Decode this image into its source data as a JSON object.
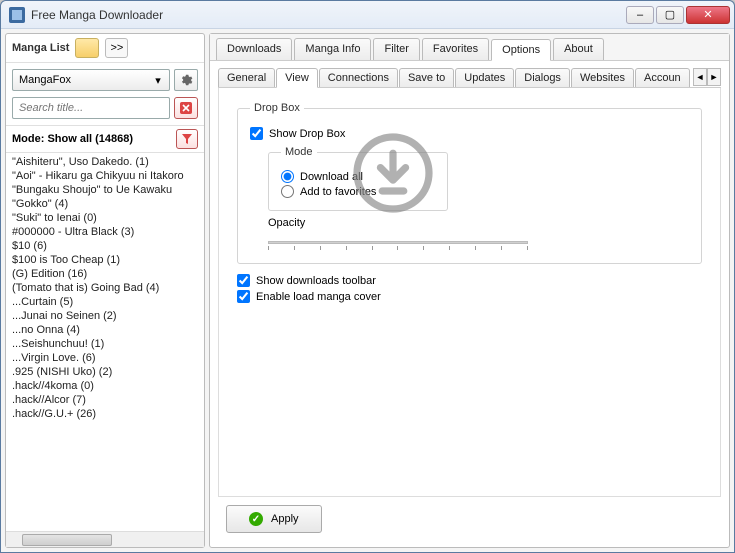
{
  "window": {
    "title": "Free Manga Downloader",
    "buttons": {
      "min": "–",
      "max": "▢",
      "close": "✕"
    }
  },
  "sidebar": {
    "title": "Manga List",
    "expand_label": ">>",
    "source": "MangaFox",
    "search_placeholder": "Search title...",
    "mode": "Mode: Show all (14868)",
    "items": [
      "\"Aishiteru\", Uso Dakedo. (1)",
      "\"Aoi\" - Hikaru ga Chikyuu ni Itakoro",
      "\"Bungaku Shoujo\" to Ue Kawaku",
      "\"Gokko\" (4)",
      "\"Suki\" to Ienai (0)",
      "#000000 - Ultra Black (3)",
      "$10 (6)",
      "$100 is Too Cheap (1)",
      "(G) Edition (16)",
      "(Tomato that is) Going Bad (4)",
      "...Curtain (5)",
      "...Junai no Seinen (2)",
      "...no Onna (4)",
      "...Seishunchuu! (1)",
      "...Virgin Love. (6)",
      ".925 (NISHI Uko) (2)",
      ".hack//4koma (0)",
      ".hack//Alcor (7)",
      ".hack//G.U.+ (26)"
    ]
  },
  "tabs": {
    "items": [
      "Downloads",
      "Manga Info",
      "Filter",
      "Favorites",
      "Options",
      "About"
    ],
    "active": "Options"
  },
  "subtabs": {
    "items": [
      "General",
      "View",
      "Connections",
      "Save to",
      "Updates",
      "Dialogs",
      "Websites",
      "Accoun"
    ],
    "active": "View"
  },
  "options": {
    "dropbox_legend": "Drop Box",
    "show_dropbox": "Show Drop Box",
    "mode_legend": "Mode",
    "mode_download": "Download all",
    "mode_favorites": "Add to favorites",
    "opacity_label": "Opacity",
    "show_toolbar": "Show downloads toolbar",
    "enable_cover": "Enable load manga cover",
    "apply": "Apply"
  }
}
